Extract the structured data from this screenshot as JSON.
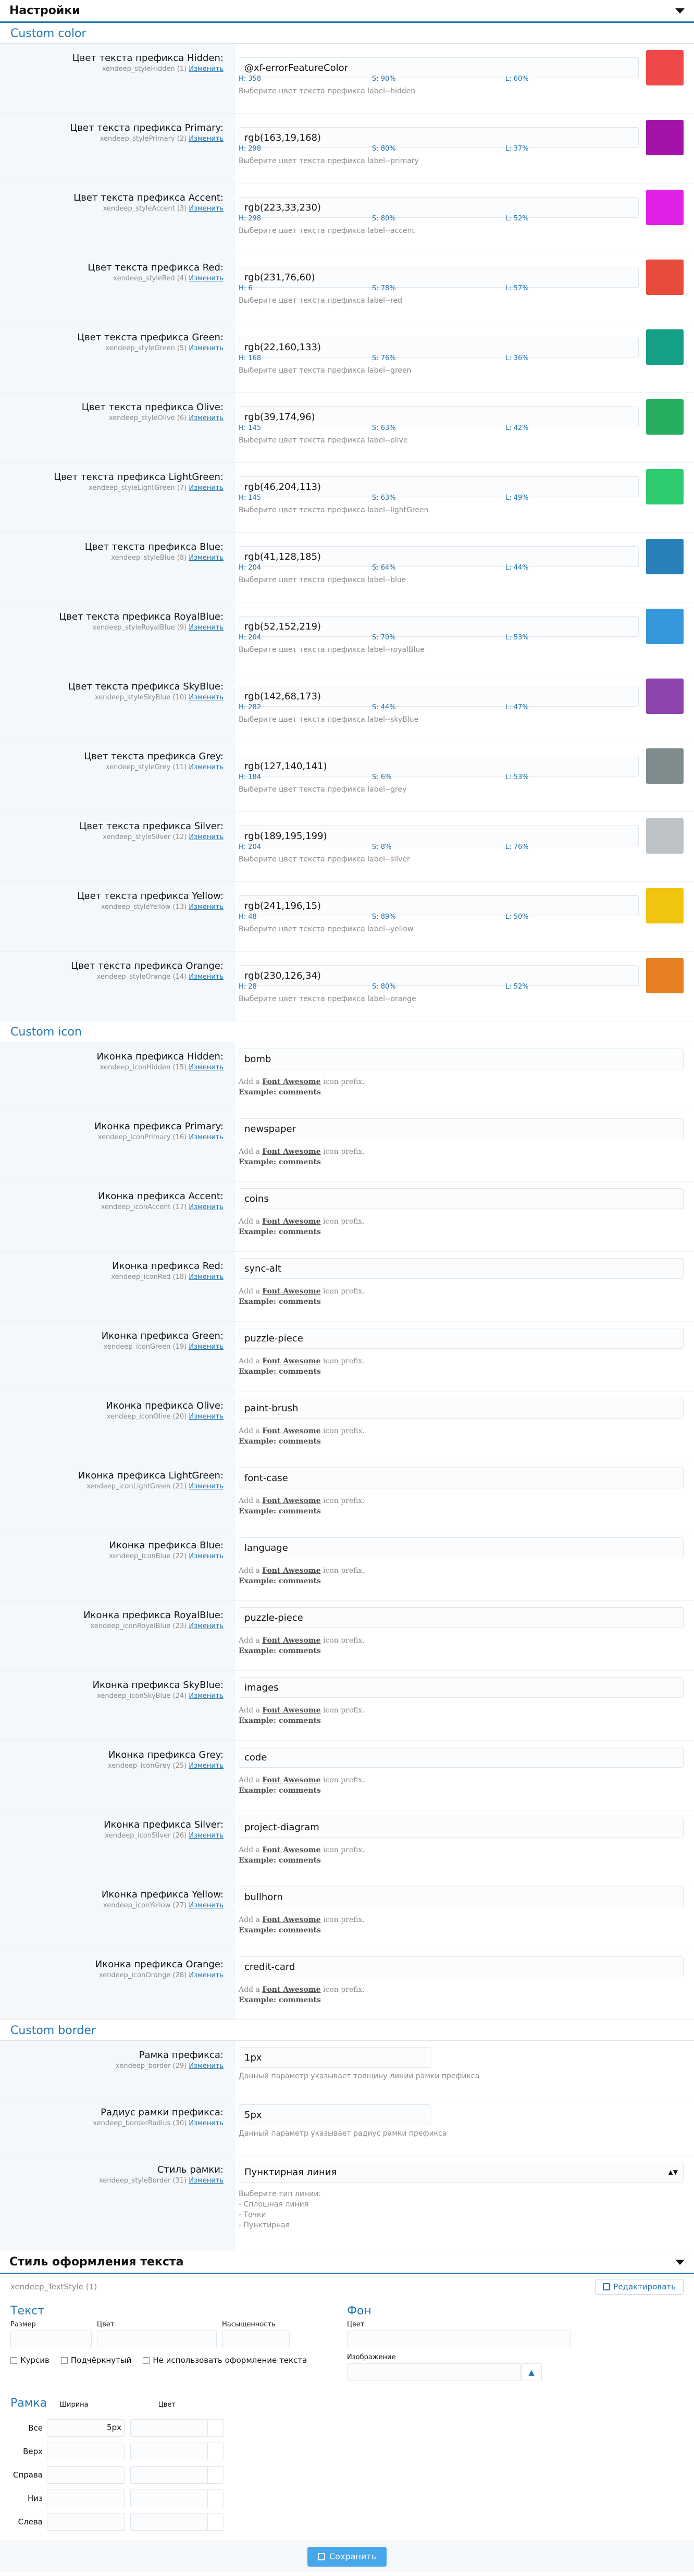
{
  "settings_header": "Настройки",
  "change_link": "Изменить",
  "color_section": {
    "title": "Custom color",
    "explain_prefix": "Выберите цвет текста префикса",
    "items": [
      {
        "label": "Цвет текста префикса Hidden:",
        "id": "xendeep_styleHidden (1)",
        "value": "@xf-errorFeatureColor",
        "swatch": "#f04949",
        "h": "H: 358",
        "s": "S: 90%",
        "l": "L: 60%",
        "explain": "Выберите цвет текста префикса label--hidden"
      },
      {
        "label": "Цвет текста префикса Primary:",
        "id": "xendeep_stylePrimary (2)",
        "value": "rgb(163,19,168)",
        "swatch": "#a313a8",
        "h": "H: 298",
        "s": "S: 80%",
        "l": "L: 37%",
        "explain": "Выберите цвет текста префикса label--primary"
      },
      {
        "label": "Цвет текста префикса Accent:",
        "id": "xendeep_styleAccent (3)",
        "value": "rgb(223,33,230)",
        "swatch": "#df21e6",
        "h": "H: 298",
        "s": "S: 80%",
        "l": "L: 52%",
        "explain": "Выберите цвет текста префикса label--accent"
      },
      {
        "label": "Цвет текста префикса Red:",
        "id": "xendeep_styleRed (4)",
        "value": "rgb(231,76,60)",
        "swatch": "#e74c3c",
        "h": "H: 6",
        "s": "S: 78%",
        "l": "L: 57%",
        "explain": "Выберите цвет текста префикса label--red"
      },
      {
        "label": "Цвет текста префикса Green:",
        "id": "xendeep_styleGreen (5)",
        "value": "rgb(22,160,133)",
        "swatch": "#16a085",
        "h": "H: 168",
        "s": "S: 76%",
        "l": "L: 36%",
        "explain": "Выберите цвет текста префикса label--green"
      },
      {
        "label": "Цвет текста префикса Olive:",
        "id": "xendeep_styleOlive (6)",
        "value": "rgb(39,174,96)",
        "swatch": "#27ae60",
        "h": "H: 145",
        "s": "S: 63%",
        "l": "L: 42%",
        "explain": "Выберите цвет текста префикса label--olive"
      },
      {
        "label": "Цвет текста префикса LightGreen:",
        "id": "xendeep_styleLightGreen (7)",
        "value": "rgb(46,204,113)",
        "swatch": "#2ecc71",
        "h": "H: 145",
        "s": "S: 63%",
        "l": "L: 49%",
        "explain": "Выберите цвет текста префикса label--lightGreen"
      },
      {
        "label": "Цвет текста префикса Blue:",
        "id": "xendeep_styleBlue (8)",
        "value": "rgb(41,128,185)",
        "swatch": "#2980b9",
        "h": "H: 204",
        "s": "S: 64%",
        "l": "L: 44%",
        "explain": "Выберите цвет текста префикса label--blue"
      },
      {
        "label": "Цвет текста префикса RoyalBlue:",
        "id": "xendeep_styleRoyalBlue (9)",
        "value": "rgb(52,152,219)",
        "swatch": "#3498db",
        "h": "H: 204",
        "s": "S: 70%",
        "l": "L: 53%",
        "explain": "Выберите цвет текста префикса label--royalBlue"
      },
      {
        "label": "Цвет текста префикса SkyBlue:",
        "id": "xendeep_styleSkyBlue (10)",
        "value": "rgb(142,68,173)",
        "swatch": "#8e44ad",
        "h": "H: 282",
        "s": "S: 44%",
        "l": "L: 47%",
        "explain": "Выберите цвет текста префикса label--skyBlue"
      },
      {
        "label": "Цвет текста префикса Grey:",
        "id": "xendeep_styleGrey (11)",
        "value": "rgb(127,140,141)",
        "swatch": "#7f8c8d",
        "h": "H: 184",
        "s": "S: 6%",
        "l": "L: 53%",
        "explain": "Выберите цвет текста префикса label--grey"
      },
      {
        "label": "Цвет текста префикса Silver:",
        "id": "xendeep_styleSilver (12)",
        "value": "rgb(189,195,199)",
        "swatch": "#bdc3c7",
        "h": "H: 204",
        "s": "S: 8%",
        "l": "L: 76%",
        "explain": "Выберите цвет текста префикса label--silver"
      },
      {
        "label": "Цвет текста префикса Yellow:",
        "id": "xendeep_styleYellow (13)",
        "value": "rgb(241,196,15)",
        "swatch": "#f1c40f",
        "h": "H: 48",
        "s": "S: 89%",
        "l": "L: 50%",
        "explain": "Выберите цвет текста префикса label--yellow"
      },
      {
        "label": "Цвет текста префикса Orange:",
        "id": "xendeep_styleOrange (14)",
        "value": "rgb(230,126,34)",
        "swatch": "#e67e22",
        "h": "H: 28",
        "s": "S: 80%",
        "l": "L: 52%",
        "explain": "Выберите цвет текста префикса label--orange"
      }
    ]
  },
  "icon_section": {
    "title": "Custom icon",
    "hint_prefix": "Add a",
    "hint_link": "Font Awesome",
    "hint_suffix": "icon prefix.",
    "example": "Example: comments",
    "items": [
      {
        "label": "Иконка префикса Hidden:",
        "id": "xendeep_iconHidden (15)",
        "value": "bomb"
      },
      {
        "label": "Иконка префикса Primary:",
        "id": "xendeep_iconPrimary (16)",
        "value": "newspaper"
      },
      {
        "label": "Иконка префикса Accent:",
        "id": "xendeep_iconAccent (17)",
        "value": "coins"
      },
      {
        "label": "Иконка префикса Red:",
        "id": "xendeep_iconRed (18)",
        "value": "sync-alt"
      },
      {
        "label": "Иконка префикса Green:",
        "id": "xendeep_iconGreen (19)",
        "value": "puzzle-piece"
      },
      {
        "label": "Иконка префикса Olive:",
        "id": "xendeep_iconOlive (20)",
        "value": "paint-brush"
      },
      {
        "label": "Иконка префикса LightGreen:",
        "id": "xendeep_iconLightGreen (21)",
        "value": "font-case"
      },
      {
        "label": "Иконка префикса Blue:",
        "id": "xendeep_iconBlue (22)",
        "value": "language"
      },
      {
        "label": "Иконка префикса RoyalBlue:",
        "id": "xendeep_iconRoyalBlue (23)",
        "value": "puzzle-piece"
      },
      {
        "label": "Иконка префикса SkyBlue:",
        "id": "xendeep_iconSkyBlue (24)",
        "value": "images"
      },
      {
        "label": "Иконка префикса Grey:",
        "id": "xendeep_iconGrey (25)",
        "value": "code"
      },
      {
        "label": "Иконка префикса Silver:",
        "id": "xendeep_iconSilver (26)",
        "value": "project-diagram"
      },
      {
        "label": "Иконка префикса Yellow:",
        "id": "xendeep_iconYellow (27)",
        "value": "bullhorn"
      },
      {
        "label": "Иконка префикса Orange:",
        "id": "xendeep_iconOrange (28)",
        "value": "credit-card"
      }
    ]
  },
  "border_section": {
    "title": "Custom border",
    "border": {
      "label": "Рамка префикса:",
      "id": "xendeep_border (29)",
      "value": "1px",
      "explain": "Данный параметр указывает толщину линии рамки префикса"
    },
    "radius": {
      "label": "Радиус рамки префикса:",
      "id": "xendeep_borderRadius (30)",
      "value": "5px",
      "explain": "Данный параметр указывает радиус рамки префикса"
    },
    "style": {
      "label": "Стиль рамки:",
      "id": "xendeep_styleBorder (31)",
      "value": "Пунктирная линия",
      "options_title": "Выберите тип линии:",
      "options": [
        "- Сплошная линия",
        "- Точки",
        "- Пунктирная"
      ]
    }
  },
  "text_style_header": "Стиль оформления текста",
  "text_style": {
    "meta": "xendeep_TextStyle (1)",
    "edit": "Редактировать",
    "text_title": "Текст",
    "size_label": "Размер",
    "color_label": "Цвет",
    "saturation_label": "Насыщенность",
    "bg_title": "Фон",
    "bg_color_label": "Цвет",
    "image_label": "Изображение",
    "italic": "Курсив",
    "underline": "Подчёркнутый",
    "no_style": "Не использовать оформление текста",
    "ramka_title": "Рамка",
    "width_label": "Ширина",
    "ramka_color_label": "Цвет",
    "sides": [
      {
        "label": "Все",
        "value": "5px"
      },
      {
        "label": "Верх",
        "value": ""
      },
      {
        "label": "Справа",
        "value": ""
      },
      {
        "label": "Низ",
        "value": ""
      },
      {
        "label": "Слева",
        "value": ""
      }
    ]
  },
  "save": "Сохранить"
}
